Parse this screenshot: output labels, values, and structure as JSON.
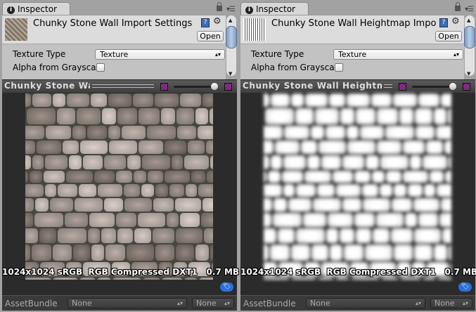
{
  "panels": [
    {
      "tab": "Inspector",
      "title": "Chunky Stone Wall Import Settings",
      "open": "Open",
      "texture_type_label": "Texture Type",
      "texture_type_value": "Texture",
      "alpha_label": "Alpha from Grayscal",
      "alpha_checked": false,
      "preview_title": "Chunky Stone Wall",
      "image_info": "1024x1024 sRGB  RGB Compressed DXT1   0.7 MB",
      "assetbundle_label": "AssetBundle",
      "assetbundle_value": "None",
      "variant_value": "None",
      "kind": "color"
    },
    {
      "tab": "Inspector",
      "title": "Chunky Stone Wall Heightmap Impo",
      "open": "Open",
      "texture_type_label": "Texture Type",
      "texture_type_value": "Texture",
      "alpha_label": "Alpha from Grayscal",
      "alpha_checked": false,
      "preview_title": "Chunky Stone Wall Heightmap",
      "image_info": "1024x1024 sRGB  RGB Compressed DXT1   0.7 MB",
      "assetbundle_label": "AssetBundle",
      "assetbundle_value": "None",
      "variant_value": "None",
      "kind": "heightmap"
    }
  ],
  "icons": {
    "info": "info-icon",
    "lock": "lock-icon",
    "menu": "menu-icon",
    "help": "help-book-icon",
    "gear": "gear-icon",
    "tag": "tag-icon"
  },
  "colors": {
    "scroll_thumb": "#7f9cc4",
    "tag": "#2a6fd8"
  }
}
